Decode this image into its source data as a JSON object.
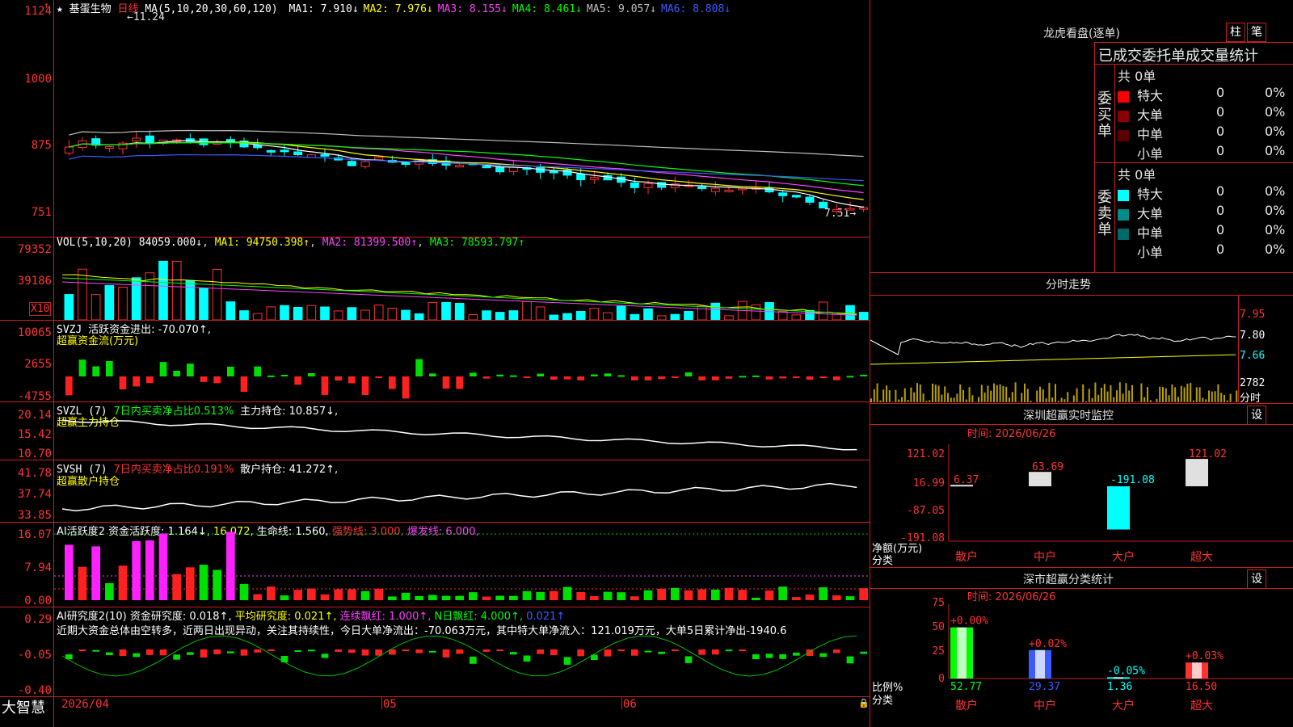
{
  "header": {
    "stock_name": "基蛋生物",
    "period": "日线",
    "ma_params": "MA(5,10,20,30,60,120)",
    "ma_items": [
      {
        "label": "MA1: 7.910↓",
        "color": "#ffffff"
      },
      {
        "label": "MA2: 7.976↓",
        "color": "#ffff00"
      },
      {
        "label": "MA3: 8.155↓",
        "color": "#ff40ff"
      },
      {
        "label": "MA4: 8.461↓",
        "color": "#00ff00"
      },
      {
        "label": "MA5: 9.057↓",
        "color": "#c0c0c0"
      },
      {
        "label": "MA6: 8.808↓",
        "color": "#3b5bff"
      }
    ],
    "high_marker": "11.24",
    "low_marker": "7.51"
  },
  "price_axis": [
    "1124",
    "1000",
    "875",
    "751"
  ],
  "vol": {
    "params": "VOL(5,10,20)",
    "value": "84059.000↓",
    "ma1": "MA1: 94750.398↑",
    "ma2": "MA2: 81399.500↑",
    "ma3": "MA3: 78593.797↑",
    "axis": [
      "79352",
      "39186"
    ],
    "unit": "X10"
  },
  "svzj": {
    "name": "SVZJ",
    "label": "活跃资金进出: -70.070↑,",
    "sub": "超赢资金流(万元)",
    "axis": [
      "10065",
      "2655",
      "-4755"
    ]
  },
  "svzl": {
    "name": "SVZL (7)",
    "ratio": "7日内买卖净占比0.513%",
    "label": "主力持仓: 10.857↓,",
    "sub": "超赢主力持仓",
    "axis": [
      "20.14",
      "15.42",
      "10.70"
    ]
  },
  "svsh": {
    "name": "SVSH (7)",
    "ratio": "7日内买卖净占比0.191%",
    "label": "散户持仓: 41.272↑,",
    "sub": "超赢散户持仓",
    "axis": [
      "41.78",
      "37.74",
      "33.85"
    ]
  },
  "ai_active": {
    "name": "AI活跃度2",
    "label": "资金活跃度: 1.164↓,",
    "v2": "16.072,",
    "life": "生命线: 1.560,",
    "strong": "强势线: 3.000,",
    "burst": "爆发线: 6.000,",
    "axis": [
      "16.07",
      "7.94",
      "0.00"
    ]
  },
  "ai_research": {
    "name": "AI研究度2(10)",
    "label": "资金研究度: 0.018↑,",
    "avg": "平均研究度: 0.021↑,",
    "cont": "连续飘红: 1.000↑,",
    "n": "N日飘红: 4.000↑,",
    "v": "0.021↑",
    "comment": "近期大资金总体由空转多，近两日出现异动，关注其持续性，今日大单净流出：-70.063万元，其中特大单净流入：121.019万元，大单5日累计净出-1940.6",
    "axis": [
      "0.29",
      "-0.05",
      "-0.40"
    ]
  },
  "bottom_axis": {
    "brand": "大智慧",
    "dates": [
      "2026/04",
      "05",
      "06"
    ]
  },
  "longhu": {
    "title": "龙虎看盘(逐单)",
    "btn1": "柱",
    "btn2": "笔",
    "section_title": "已成交委托单成交量统计",
    "buy_label": "委买单",
    "sell_label": "委卖单",
    "buy_total": "共 0单",
    "sell_total": "共 0单",
    "buy_rows": [
      {
        "name": "特大",
        "v": "0",
        "p": "0%",
        "color": "#ff0000"
      },
      {
        "name": "大单",
        "v": "0",
        "p": "0%",
        "color": "#8b0000"
      },
      {
        "name": "中单",
        "v": "0",
        "p": "0%",
        "color": "#5a0000"
      },
      {
        "name": "小单",
        "v": "0",
        "p": "0%",
        "color": ""
      }
    ],
    "sell_rows": [
      {
        "name": "特大",
        "v": "0",
        "p": "0%",
        "color": "#00ffff"
      },
      {
        "name": "大单",
        "v": "0",
        "p": "0%",
        "color": "#008b8b"
      },
      {
        "name": "中单",
        "v": "0",
        "p": "0%",
        "color": "#006a6a"
      },
      {
        "name": "小单",
        "v": "0",
        "p": "0%",
        "color": ""
      }
    ]
  },
  "minute": {
    "title": "分时走势",
    "axis": [
      "7.95",
      "7.80",
      "7.66",
      "2782"
    ],
    "unit": "分时"
  },
  "sz_monitor": {
    "title": "深圳超赢实时监控",
    "btn": "设",
    "time": "时间: 2026/06/26",
    "axis": [
      "121.02",
      "16.99",
      "-87.05",
      "-191.08"
    ],
    "ylabel": "净额(万元)",
    "xlabel": "分类",
    "cats": [
      "散户",
      "中户",
      "大户",
      "超大"
    ],
    "values": [
      6.37,
      63.69,
      -191.08,
      121.02
    ],
    "labels": [
      "6.37",
      "63.69",
      "-191.08",
      "121.02"
    ]
  },
  "sz_class": {
    "title": "深市超赢分类统计",
    "btn": "设",
    "time": "时间: 2026/06/26",
    "axis": [
      "75",
      "50",
      "25",
      "0"
    ],
    "ylabel": "比例%",
    "xlabel": "分类",
    "cats": [
      "散户",
      "中户",
      "大户",
      "超大"
    ],
    "values": [
      52.77,
      29.37,
      1.36,
      16.5
    ],
    "labels": [
      "52.77",
      "29.37",
      "1.36",
      "16.50"
    ],
    "changes": [
      "+0.00%",
      "+0.02%",
      "-0.05%",
      "+0.03%"
    ]
  }
}
